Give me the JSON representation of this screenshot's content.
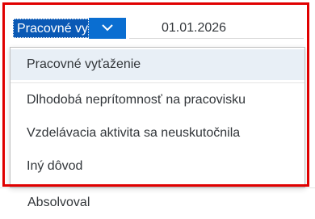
{
  "combo": {
    "selected_value": "Pracovné vy",
    "arrow_icon": "chevron-down-icon"
  },
  "date_field": {
    "value": "01.01.2026"
  },
  "dropdown": {
    "items": [
      {
        "label": "Pracovné vyťaženie",
        "selected": true
      },
      {
        "label": "Dlhodobá neprítomnosť na pracovisku",
        "selected": false
      },
      {
        "label": "Vzdelávacia aktivita sa neuskutočnila",
        "selected": false
      },
      {
        "label": "Iný dôvod",
        "selected": false
      }
    ]
  },
  "background_list": {
    "row_label": "Absolvoval"
  },
  "colors": {
    "highlight": "#e00000",
    "select_bg": "#0a59b5",
    "arrow_bg": "#0a6ed1",
    "selected_item_bg": "#e8eff6"
  }
}
